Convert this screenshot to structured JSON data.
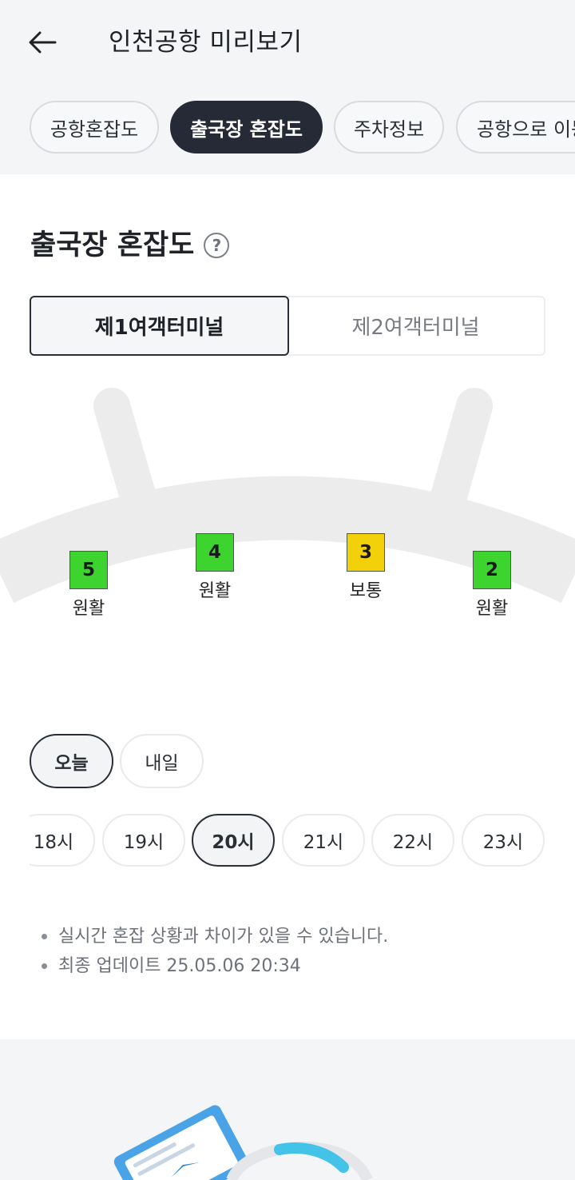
{
  "header": {
    "title": "인천공항 미리보기"
  },
  "tabs": [
    {
      "label": "공항혼잡도"
    },
    {
      "label": "출국장 혼잡도"
    },
    {
      "label": "주차정보"
    },
    {
      "label": "공항으로 이동"
    }
  ],
  "active_tab": "출국장 혼잡도",
  "section": {
    "title": "출국장 혼잡도"
  },
  "terminals": [
    {
      "label": "제1여객터미널",
      "selected": true
    },
    {
      "label": "제2여객터미널",
      "selected": false
    }
  ],
  "gates": [
    {
      "number": "5",
      "status": "원활",
      "color": "#3dd42f"
    },
    {
      "number": "4",
      "status": "원활",
      "color": "#3dd42f"
    },
    {
      "number": "3",
      "status": "보통",
      "color": "#f2d10a"
    },
    {
      "number": "2",
      "status": "원활",
      "color": "#3dd42f"
    }
  ],
  "days": [
    {
      "label": "오늘",
      "selected": true
    },
    {
      "label": "내일",
      "selected": false
    }
  ],
  "hours": [
    {
      "label": "18시",
      "selected": false
    },
    {
      "label": "19시",
      "selected": false
    },
    {
      "label": "20시",
      "selected": true
    },
    {
      "label": "21시",
      "selected": false
    },
    {
      "label": "22시",
      "selected": false
    },
    {
      "label": "23시",
      "selected": false
    }
  ],
  "notes": [
    "실시간 혼잡 상황과 차이가 있을 수 있습니다.",
    "최종 업데이트 25.05.06 20:34"
  ],
  "icons": {
    "back": "back-arrow-icon",
    "help": "question-icon",
    "ticket": "boarding-pass-icon"
  },
  "colors": {
    "accent_dark": "#252a36",
    "smooth": "#3dd42f",
    "normal": "#f2d10a"
  }
}
